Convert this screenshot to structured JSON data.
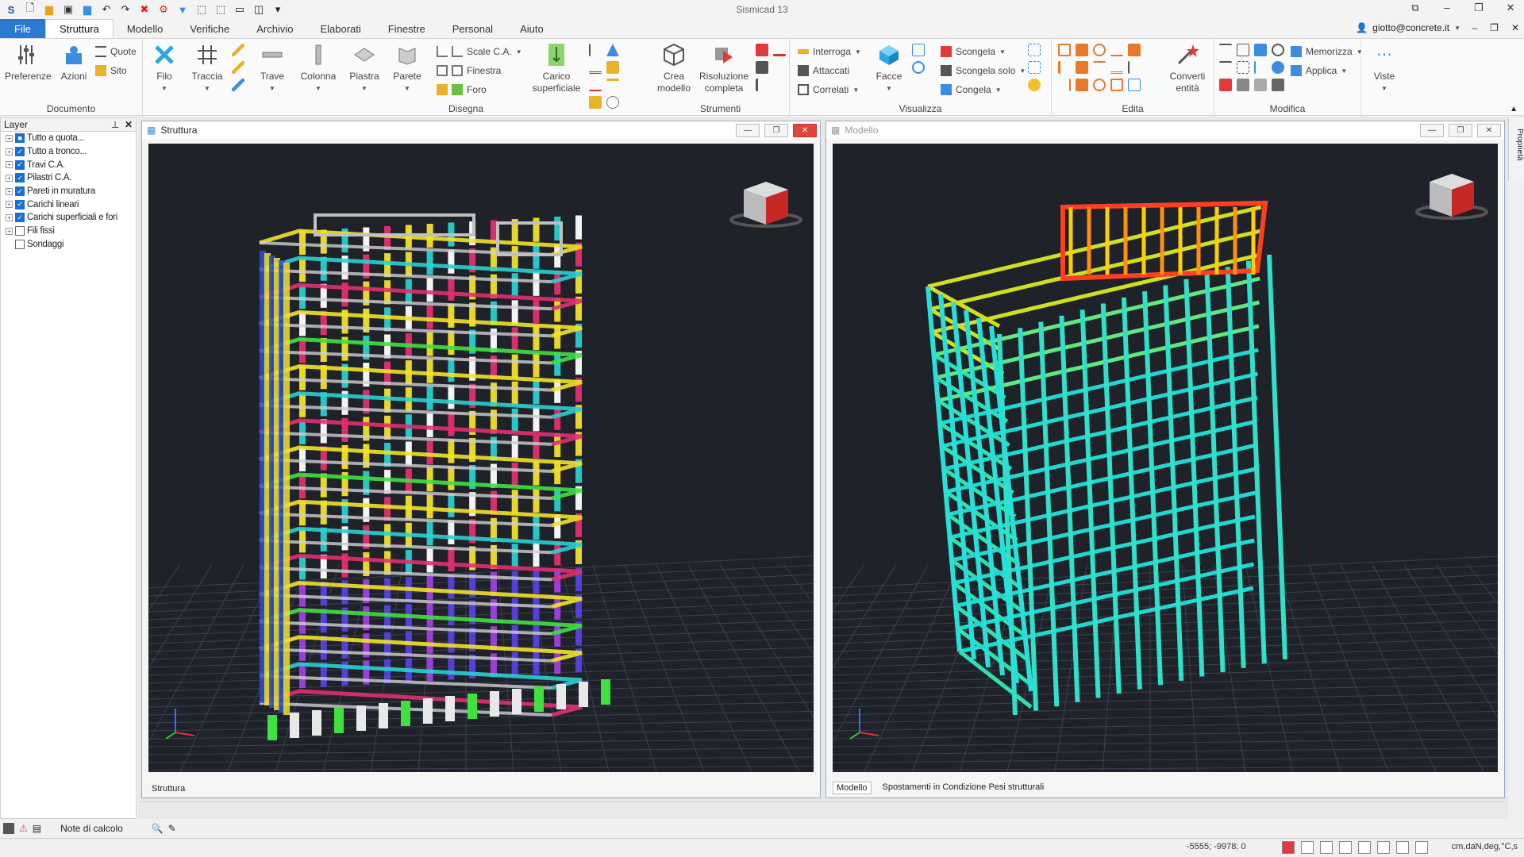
{
  "app": {
    "title": "Sismicad 13"
  },
  "quick_access": [
    "app-logo-icon",
    "new-icon",
    "open-icon",
    "save-icon",
    "folder-icon",
    "undo-icon",
    "redo-icon",
    "delete-icon",
    "tool-icon",
    "filter-icon",
    "select-icon",
    "frame-icon",
    "view-icon",
    "layout-icon",
    "more-icon"
  ],
  "tabs": [
    "File",
    "Struttura",
    "Modello",
    "Verifiche",
    "Archivio",
    "Elaborati",
    "Finestre",
    "Personal",
    "Aiuto"
  ],
  "active_tab": "Struttura",
  "user": "giotto@concrete.it",
  "ribbon": {
    "documento": {
      "label": "Documento",
      "preferenze": "Preferenze",
      "azioni": "Azioni",
      "quote": "Quote",
      "sito": "Sito"
    },
    "disegna": {
      "label": "Disegna",
      "filo": "Filo",
      "traccia": "Traccia",
      "trave": "Trave",
      "colonna": "Colonna",
      "piastra": "Piastra",
      "parete": "Parete",
      "scale": "Scale C.A.",
      "finestra": "Finestra",
      "foro": "Foro",
      "carico": "Carico superficiale"
    },
    "strumenti": {
      "label": "Strumenti",
      "crea": "Crea modello",
      "risoluzione": "Risoluzione completa"
    },
    "visualizza": {
      "label": "Visualizza",
      "interroga": "Interroga",
      "attaccati": "Attaccati",
      "correlati": "Correlati",
      "facce": "Facce",
      "scongela": "Scongela",
      "scongela_solo": "Scongela solo",
      "congela": "Congela"
    },
    "edita": {
      "label": "Edita",
      "converti": "Converti entità"
    },
    "modifica": {
      "label": "Modifica",
      "memorizza": "Memorizza",
      "applica": "Applica",
      "viste": "Viste"
    }
  },
  "layer_panel": {
    "title": "Layer",
    "items": [
      {
        "label": "Tutto a quota...",
        "checked": true,
        "expand": true,
        "partial": true
      },
      {
        "label": "Tutto a tronco...",
        "checked": true,
        "expand": true
      },
      {
        "label": "Travi C.A.",
        "checked": true,
        "expand": true
      },
      {
        "label": "Pilastri C.A.",
        "checked": true,
        "expand": true
      },
      {
        "label": "Pareti in muratura",
        "checked": true,
        "expand": true
      },
      {
        "label": "Carichi lineari",
        "checked": true,
        "expand": true
      },
      {
        "label": "Carichi superficiali e fori",
        "checked": true,
        "expand": true
      },
      {
        "label": "Fili fissi",
        "checked": false,
        "expand": true
      },
      {
        "label": "Sondaggi",
        "checked": false,
        "expand": false
      }
    ]
  },
  "windows": {
    "struttura": {
      "title": "Struttura",
      "tabs": [
        "Struttura"
      ]
    },
    "modello": {
      "title": "Modello",
      "tabs": [
        "Modello",
        "Spostamenti in Condizione Pesi strutturali"
      ]
    }
  },
  "status": {
    "note": "Note di calcolo",
    "coords": "-5555; -9978; 0",
    "units": "cm,daN,deg,°C,s",
    "proprieta": "Proprietà"
  },
  "colors": {
    "accent": "#2b79d0",
    "viewport_bg": "#1f2229"
  }
}
